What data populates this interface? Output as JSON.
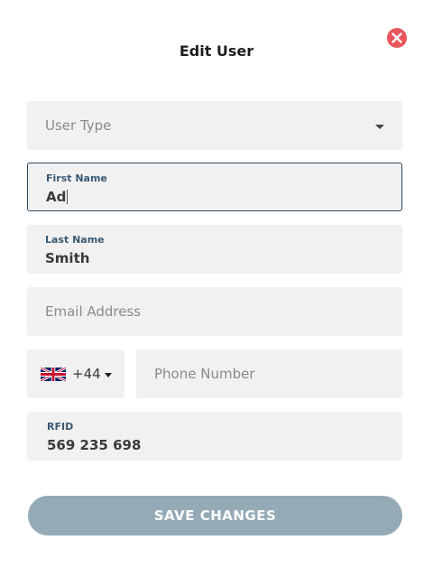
{
  "dialog": {
    "title": "Edit User"
  },
  "form": {
    "user_type": {
      "placeholder": "User Type"
    },
    "first_name": {
      "label": "First Name",
      "value": "Ad"
    },
    "last_name": {
      "label": "Last Name",
      "value": "Smith"
    },
    "email": {
      "placeholder": "Email Address"
    },
    "phone": {
      "country_flag": "uk-flag-icon",
      "dial_code": "+44",
      "placeholder": "Phone Number"
    },
    "rfid": {
      "label": "RFID",
      "value": "569 235 698"
    }
  },
  "actions": {
    "save_label": "SAVE CHANGES"
  },
  "colors": {
    "close_icon": "#e8555b",
    "label_text": "#3b5a73",
    "field_bg": "#f1f1f1",
    "active_border": "#2f4a5f",
    "save_button_bg": "#94aab6"
  }
}
